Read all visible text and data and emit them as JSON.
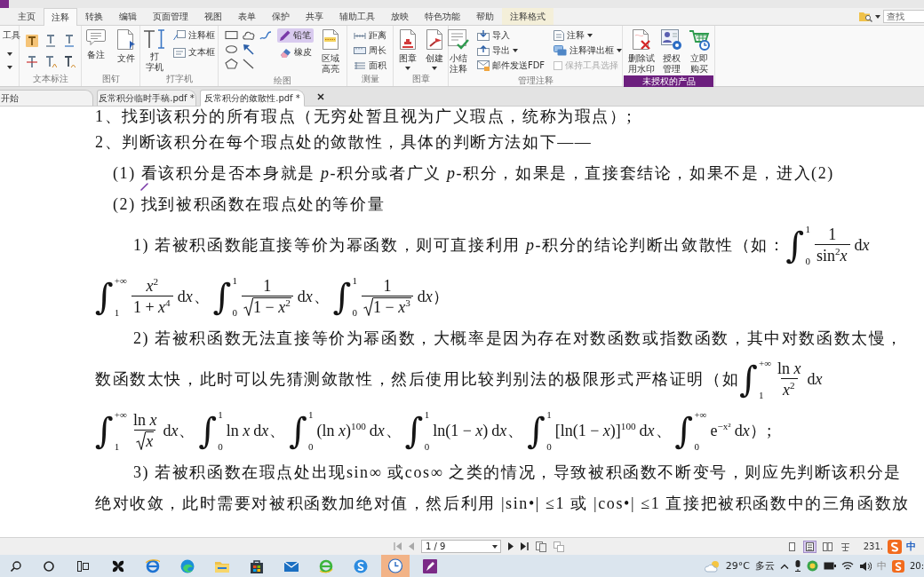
{
  "menu_tabs": [
    {
      "label": "主页",
      "selected": false,
      "kind": "normal"
    },
    {
      "label": "注释",
      "selected": true,
      "kind": "normal"
    },
    {
      "label": "转换",
      "selected": false,
      "kind": "normal"
    },
    {
      "label": "编辑",
      "selected": false,
      "kind": "normal"
    },
    {
      "label": "页面管理",
      "selected": false,
      "kind": "normal"
    },
    {
      "label": "视图",
      "selected": false,
      "kind": "normal"
    },
    {
      "label": "表单",
      "selected": false,
      "kind": "normal"
    },
    {
      "label": "保护",
      "selected": false,
      "kind": "normal"
    },
    {
      "label": "共享",
      "selected": false,
      "kind": "normal"
    },
    {
      "label": "辅助工具",
      "selected": false,
      "kind": "normal"
    },
    {
      "label": "放映",
      "selected": false,
      "kind": "normal"
    },
    {
      "label": "特色功能",
      "selected": false,
      "kind": "normal"
    },
    {
      "label": "帮助",
      "selected": false,
      "kind": "normal"
    },
    {
      "label": "注释格式",
      "selected": false,
      "kind": "contextual"
    }
  ],
  "search": {
    "placeholder": "查找"
  },
  "ribbon": [
    {
      "kind": "tools",
      "items": [
        {
          "label": "工具"
        }
      ]
    },
    {
      "kind": "text_markup",
      "label": "文本标注"
    },
    {
      "kind": "pin",
      "label": "图钉",
      "items": [
        {
          "label": "备注"
        },
        {
          "label": "文件"
        }
      ]
    },
    {
      "kind": "typewriter",
      "label": "打字机",
      "items": [
        {
          "label_lines": [
            "打",
            "字机"
          ]
        },
        {
          "label": "注释框"
        },
        {
          "label": "文本框"
        }
      ]
    },
    {
      "kind": "drawing",
      "label": "绘图",
      "shapes": [
        {
          "selected": false
        },
        {
          "selected": false
        },
        {
          "selected": false
        },
        {
          "selected": false
        },
        {
          "selected": false
        },
        {
          "selected": false
        },
        {
          "selected": false
        }
      ],
      "items": [
        {
          "label": "铅笔",
          "selected": true
        },
        {
          "label": "橡皮",
          "selected": false
        },
        {
          "label_lines": [
            "区域",
            "高亮"
          ],
          "selected": false
        }
      ]
    },
    {
      "kind": "measure",
      "label": "测量",
      "items": [
        {
          "label": "距离"
        },
        {
          "label": "周长"
        },
        {
          "label": "面积"
        }
      ]
    },
    {
      "kind": "stamp",
      "label": "图章",
      "items": [
        {
          "label": "图章"
        },
        {
          "label": "创建"
        }
      ]
    },
    {
      "kind": "manage",
      "label": "管理注释",
      "items": [
        {
          "label_lines": [
            "小结",
            "注释"
          ]
        },
        {
          "label": "导入"
        },
        {
          "label": "导出"
        },
        {
          "label": "邮件发送FDF"
        },
        {
          "label": "注释"
        },
        {
          "label": "注释弹出框"
        },
        {
          "label": "保持工具选择",
          "checked": false,
          "disabled": true
        }
      ]
    },
    {
      "kind": "license",
      "label": "未授权的产品",
      "items": [
        {
          "label_lines": [
            "删除试",
            "用水印"
          ]
        },
        {
          "label_lines": [
            "授权",
            "管理"
          ]
        },
        {
          "label_lines": [
            "立即",
            "购买"
          ]
        }
      ]
    }
  ],
  "doc_tabs": [
    {
      "label": "开始",
      "selected": false
    },
    {
      "label": "反常积分临时手稿.pdf *",
      "selected": false
    },
    {
      "label": "反常积分的敛散性.pdf *",
      "selected": true
    }
  ],
  "document": {
    "lines": [
      {
        "kind": "step",
        "parts": [
          {
            "kind": "text",
            "text": "1、找到该积分的所有瑕点（无穷处暂且视为广义瑕点，统称为瑕点）;"
          }
        ]
      },
      {
        "kind": "step",
        "parts": [
          {
            "kind": "text",
            "text": "2、判断该积分在每个瑕点处的敛散性，具体的判断方法如下——"
          }
        ]
      },
      {
        "kind": "case",
        "parts": [
          {
            "kind": "text",
            "text": "(1) 看该积分是否本身就是 *p*-积分或者广义 *p*-积分，如果是，直接套结论，如果不是，进入(2)"
          }
        ]
      },
      {
        "kind": "case",
        "parts": [
          {
            "kind": "text",
            "text": "(2) 找到被积函数在瑕点处的等价量"
          }
        ]
      },
      {
        "kind": "method",
        "parts": [
          {
            "kind": "text",
            "text": "1) 若被积函数能直接等价为幂函数，则可直接利用 *p*-积分的结论判断出敛散性（如："
          },
          {
            "kind": "integral",
            "sign": "∫",
            "lower": "0",
            "upper": "1",
            "integrand": {
              "kind": "frac",
              "num": "1",
              "den": "sin$^{2}$*x*",
              "root": false
            },
            "differential": {
              "operator": "d",
              "variable": "x"
            }
          }
        ]
      },
      {
        "kind": "continued",
        "parts": [
          {
            "kind": "integral",
            "sign": "∫",
            "lower": "1",
            "upper": "+∞",
            "integrand": {
              "kind": "frac",
              "num": "*x*$^{2}$",
              "den": "1 + *x*$^{4}$",
              "root": false
            },
            "differential": {
              "operator": "d",
              "variable": "x"
            }
          },
          {
            "kind": "punct",
            "text": "、"
          },
          {
            "kind": "integral",
            "sign": "∫",
            "lower": "0",
            "upper": "1",
            "integrand": {
              "kind": "frac",
              "num": "1",
              "den": "1 − *x*$^{2}$",
              "root": true
            },
            "differential": {
              "operator": "d",
              "variable": "x"
            }
          },
          {
            "kind": "punct",
            "text": "、"
          },
          {
            "kind": "integral",
            "sign": "∫",
            "lower": "0",
            "upper": "1",
            "integrand": {
              "kind": "frac",
              "num": "1",
              "den": "1 − *x*$^{3}$",
              "root": true
            },
            "differential": {
              "operator": "d",
              "variable": "x"
            }
          },
          {
            "kind": "text",
            "text": "）"
          }
        ]
      },
      {
        "kind": "method",
        "parts": [
          {
            "kind": "text",
            "text": "2) 若被积函数无法直接等价为幂函数，大概率是因为存在对数函数或指数函数，其中对数函数太慢，"
          }
        ]
      },
      {
        "kind": "continued",
        "parts": [
          {
            "kind": "text",
            "text": "数函数太快，此时可以先猜测敛散性，然后使用比较判别法的极限形式严格证明（如"
          },
          {
            "kind": "integral",
            "sign": "∫",
            "lower": "1",
            "upper": "+∞",
            "integrand": {
              "kind": "frac",
              "num": "ln *x*",
              "den": "*x*$^{2}$",
              "root": false
            },
            "differential": {
              "operator": "d",
              "variable": "x"
            }
          }
        ]
      },
      {
        "kind": "continued",
        "parts": [
          {
            "kind": "integral",
            "sign": "∫",
            "lower": "1",
            "upper": "+∞",
            "integrand": {
              "kind": "frac",
              "num": "ln *x*",
              "den": "*x*",
              "root": true
            },
            "differential": {
              "operator": "d",
              "variable": "x"
            }
          },
          {
            "kind": "punct",
            "text": "、"
          },
          {
            "kind": "integral",
            "sign": "∫",
            "lower": "0",
            "upper": "1",
            "integrand": {
              "kind": "plain",
              "text": "ln *x*"
            },
            "differential": {
              "operator": "d",
              "variable": "x"
            }
          },
          {
            "kind": "punct",
            "text": "、"
          },
          {
            "kind": "integral",
            "sign": "∫",
            "lower": "0",
            "upper": "1",
            "integrand": {
              "kind": "plain",
              "text": "(ln *x*)$^{100}$"
            },
            "differential": {
              "operator": "d",
              "variable": "x"
            }
          },
          {
            "kind": "punct",
            "text": "、"
          },
          {
            "kind": "integral",
            "sign": "∫",
            "lower": "0",
            "upper": "1",
            "integrand": {
              "kind": "plain",
              "text": "ln(1 − *x*)"
            },
            "differential": {
              "operator": "d",
              "variable": "x"
            }
          },
          {
            "kind": "punct",
            "text": "、"
          },
          {
            "kind": "integral",
            "sign": "∫",
            "lower": "0",
            "upper": "1",
            "integrand": {
              "kind": "plain",
              "text": "[ln(1 − *x*)]$^{100}$"
            },
            "differential": {
              "operator": "d",
              "variable": "x"
            }
          },
          {
            "kind": "punct",
            "text": "、"
          },
          {
            "kind": "integral",
            "sign": "∫",
            "lower": "0",
            "upper": "+∞",
            "integrand": {
              "kind": "plain",
              "text": "e$^{−x²}$"
            },
            "differential": {
              "operator": "d",
              "variable": "x"
            }
          },
          {
            "kind": "text",
            "text": "）;"
          }
        ]
      },
      {
        "kind": "method",
        "parts": [
          {
            "kind": "text",
            "text": "3) 若被积函数在瑕点处出现sin∞ 或cos∞ 之类的情况，导致被积函数不断变号，则应先判断该积分是"
          }
        ]
      },
      {
        "kind": "continued",
        "parts": [
          {
            "kind": "text",
            "text": "绝对收敛，此时需要对被积函数加绝对值，然后利用 |sin•| ≤1 或 |cos•| ≤1 直接把被积函数中的三角函数放"
          }
        ]
      }
    ]
  },
  "status_bar": {
    "page_field": {
      "value": "1 / 9"
    },
    "view_modes": [
      {
        "selected": false
      },
      {
        "selected": true
      },
      {
        "selected": false
      },
      {
        "selected": false
      }
    ],
    "zoom": "231.",
    "ime_mode": "中"
  },
  "taskbar": {
    "apps": [
      {
        "highlighted": false
      },
      {
        "highlighted": false
      },
      {
        "highlighted": false
      },
      {
        "highlighted": false
      },
      {
        "highlighted": false
      },
      {
        "highlighted": false
      },
      {
        "highlighted": false
      },
      {
        "highlighted": false
      },
      {
        "highlighted": true
      },
      {
        "highlighted": false
      }
    ],
    "weather": {
      "temperature": "29°C",
      "condition": "多云"
    },
    "ime_mode": "中",
    "clock": {
      "time": "20:"
    }
  }
}
